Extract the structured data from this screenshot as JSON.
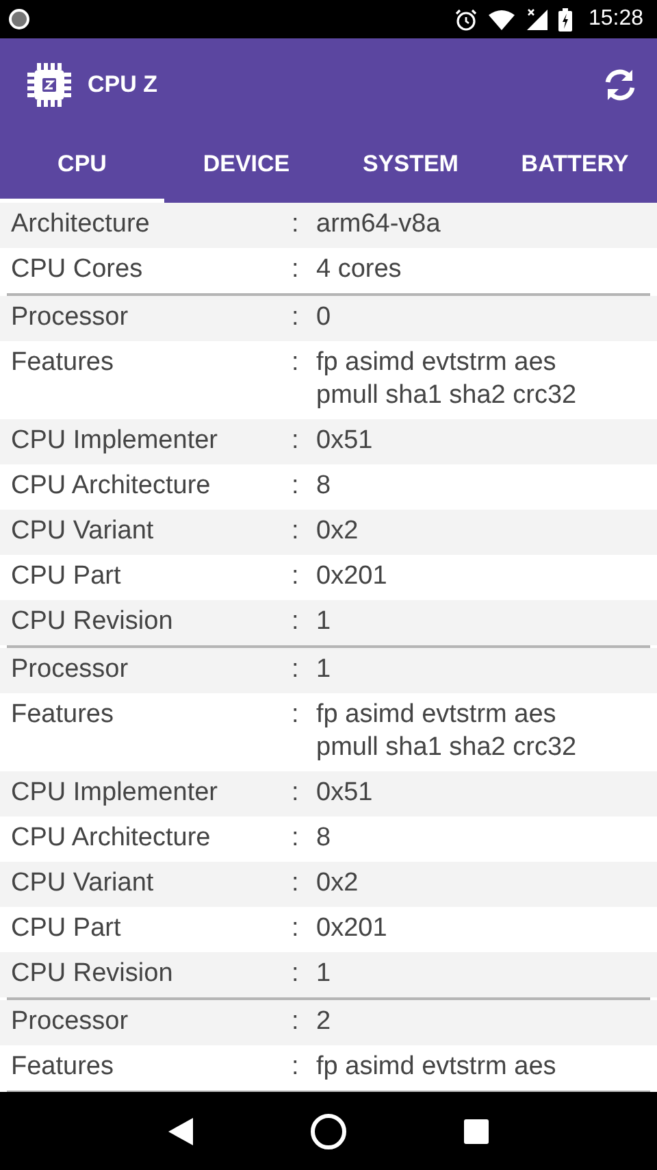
{
  "status_bar": {
    "time": "15:28"
  },
  "app_bar": {
    "title": "CPU Z"
  },
  "tabs": [
    {
      "label": "CPU",
      "selected": true
    },
    {
      "label": "DEVICE",
      "selected": false
    },
    {
      "label": "SYSTEM",
      "selected": false
    },
    {
      "label": "BATTERY",
      "selected": false
    }
  ],
  "groups": [
    {
      "rows": [
        {
          "label": "Architecture",
          "separator": ":",
          "value": "arm64-v8a"
        },
        {
          "label": "CPU Cores",
          "separator": ":",
          "value": "4 cores"
        }
      ]
    },
    {
      "rows": [
        {
          "label": "Processor",
          "separator": ":",
          "value": "0"
        },
        {
          "label": "Features",
          "separator": ":",
          "value": "fp asimd evtstrm aes pmull sha1 sha2 crc32"
        },
        {
          "label": "CPU Implementer",
          "separator": ":",
          "value": "0x51"
        },
        {
          "label": "CPU Architecture",
          "separator": ":",
          "value": "8"
        },
        {
          "label": "CPU Variant",
          "separator": ":",
          "value": "0x2"
        },
        {
          "label": "CPU Part",
          "separator": ":",
          "value": "0x201"
        },
        {
          "label": "CPU Revision",
          "separator": ":",
          "value": "1"
        }
      ]
    },
    {
      "rows": [
        {
          "label": "Processor",
          "separator": ":",
          "value": "1"
        },
        {
          "label": "Features",
          "separator": ":",
          "value": "fp asimd evtstrm aes pmull sha1 sha2 crc32"
        },
        {
          "label": "CPU Implementer",
          "separator": ":",
          "value": "0x51"
        },
        {
          "label": "CPU Architecture",
          "separator": ":",
          "value": "8"
        },
        {
          "label": "CPU Variant",
          "separator": ":",
          "value": "0x2"
        },
        {
          "label": "CPU Part",
          "separator": ":",
          "value": "0x201"
        },
        {
          "label": "CPU Revision",
          "separator": ":",
          "value": "1"
        }
      ]
    },
    {
      "rows": [
        {
          "label": "Processor",
          "separator": ":",
          "value": "2"
        },
        {
          "label": "Features",
          "separator": ":",
          "value": "fp asimd evtstrm aes"
        }
      ]
    }
  ]
}
